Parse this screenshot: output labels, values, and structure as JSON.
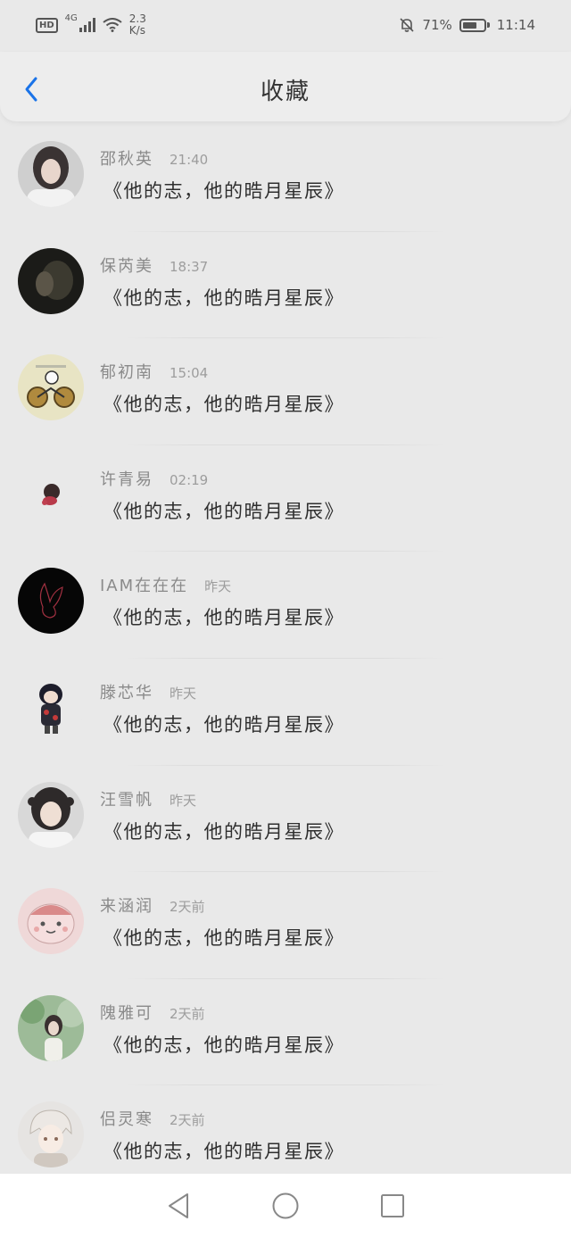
{
  "status_bar": {
    "hd": "HD",
    "net_type": "4G",
    "speed_value": "2.3",
    "speed_unit": "K/s",
    "battery": "71%",
    "battery_level": 0.71,
    "time": "11:14"
  },
  "header": {
    "title": "收藏",
    "accent_color": "#1a73e8"
  },
  "items": [
    {
      "name": "邵秋英",
      "time": "21:40",
      "message": "《他的志，他的晧月星辰》",
      "avatar": "photo-girl-avatar"
    },
    {
      "name": "保芮美",
      "time": "18:37",
      "message": "《他的志，他的晧月星辰》",
      "avatar": "dark-photo-avatar"
    },
    {
      "name": "郁初南",
      "time": "15:04",
      "message": "《他的志，他的晧月星辰》",
      "avatar": "cartoon-bike-avatar"
    },
    {
      "name": "许青易",
      "time": "02:19",
      "message": "《他的志，他的晧月星辰》",
      "avatar": "small-character-avatar"
    },
    {
      "name": "IAM在在在",
      "time": "昨天",
      "message": "《他的志，他的晧月星辰》",
      "avatar": "black-rabbit-avatar"
    },
    {
      "name": "滕芯华",
      "time": "昨天",
      "message": "《他的志，他的晧月星辰》",
      "avatar": "anime-ninja-avatar"
    },
    {
      "name": "汪雪帆",
      "time": "昨天",
      "message": "《他的志，他的晧月星辰》",
      "avatar": "photo-girl-avatar"
    },
    {
      "name": "来涵润",
      "time": "2天前",
      "message": "《他的志，他的晧月星辰》",
      "avatar": "pink-cartoon-avatar"
    },
    {
      "name": "隗雅可",
      "time": "2天前",
      "message": "《他的志，他的晧月星辰》",
      "avatar": "nature-photo-avatar"
    },
    {
      "name": "侣灵寒",
      "time": "2天前",
      "message": "《他的志，他的晧月星辰》",
      "avatar": "anime-boy-avatar"
    }
  ]
}
